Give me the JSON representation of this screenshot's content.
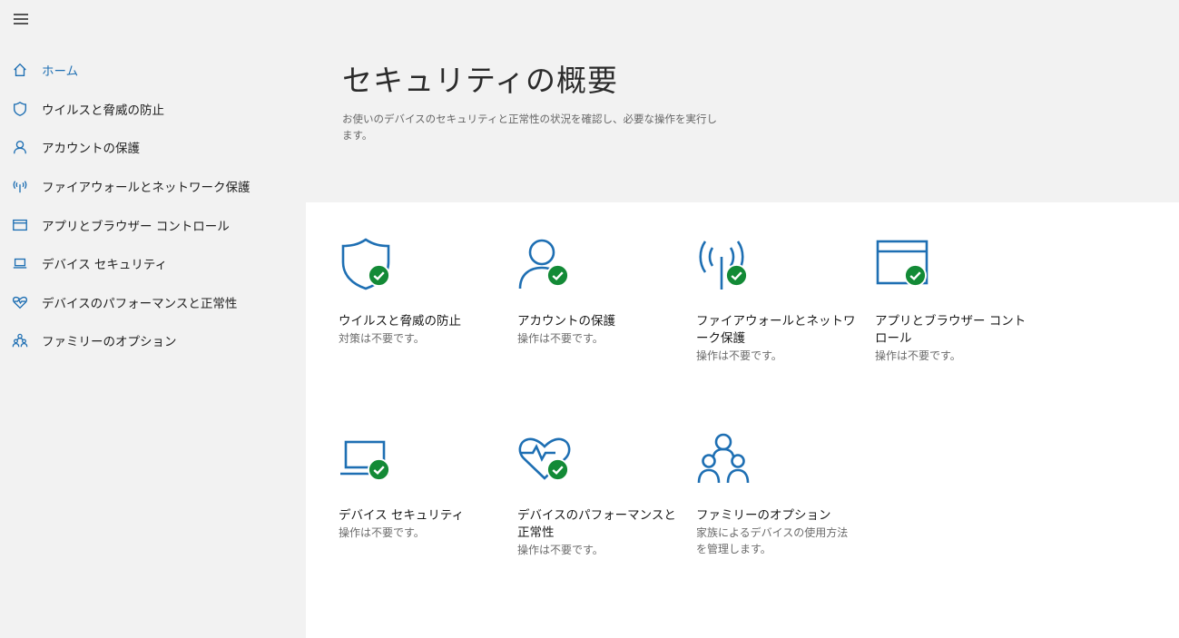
{
  "header": {
    "title": "セキュリティの概要",
    "description": "お使いのデバイスのセキュリティと正常性の状況を確認し、必要な操作を実行します。"
  },
  "sidebar": {
    "items": [
      {
        "label": "ホーム",
        "icon": "home-icon",
        "active": true
      },
      {
        "label": "ウイルスと脅威の防止",
        "icon": "shield-icon"
      },
      {
        "label": "アカウントの保護",
        "icon": "person-icon"
      },
      {
        "label": "ファイアウォールとネットワーク保護",
        "icon": "wifi-antenna-icon"
      },
      {
        "label": "アプリとブラウザー コントロール",
        "icon": "browser-window-icon"
      },
      {
        "label": "デバイス セキュリティ",
        "icon": "laptop-icon"
      },
      {
        "label": "デバイスのパフォーマンスと正常性",
        "icon": "heart-icon"
      },
      {
        "label": "ファミリーのオプション",
        "icon": "family-icon"
      }
    ]
  },
  "tiles": [
    {
      "title": "ウイルスと脅威の防止",
      "status": "対策は不要です。",
      "icon": "shield-icon"
    },
    {
      "title": "アカウントの保護",
      "status": "操作は不要です。",
      "icon": "person-icon"
    },
    {
      "title": "ファイアウォールとネットワーク保護",
      "status": "操作は不要です。",
      "icon": "wifi-antenna-icon"
    },
    {
      "title": "アプリとブラウザー コントロール",
      "status": "操作は不要です。",
      "icon": "browser-window-icon"
    },
    {
      "title": "デバイス セキュリティ",
      "status": "操作は不要です。",
      "icon": "laptop-icon"
    },
    {
      "title": "デバイスのパフォーマンスと正常性",
      "status": "操作は不要です。",
      "icon": "heart-icon"
    },
    {
      "title": "ファミリーのオプション",
      "status": "家族によるデバイスの使用方法を管理します。",
      "icon": "family-icon"
    }
  ],
  "colors": {
    "accent": "#1e6fb3",
    "check": "#138a36",
    "sidebar_bg": "#f2f2f2",
    "content_bg": "#ffffff"
  }
}
